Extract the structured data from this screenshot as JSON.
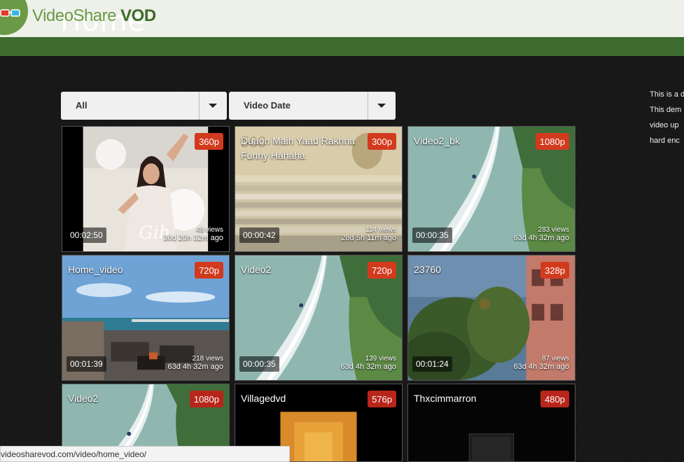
{
  "header": {
    "ghost_title": "Home",
    "logo_part1": "VideoShare",
    "logo_part2": "VOD"
  },
  "filters": {
    "category_selected": "All",
    "sort_selected": "Video Date"
  },
  "videos": [
    {
      "title": "",
      "quality": "360p",
      "duration": "00:02:50",
      "views": "48 views",
      "ago": "30d 20h 32m ago",
      "badge_color": "#d23a1e"
    },
    {
      "title": "Duaon Main Yaad Rakhna Funny Hahaha",
      "quality": "300p",
      "duration": "00:00:42",
      "views": "114 views",
      "ago": "28d 5h 11m ago",
      "badge_color": "#d23a1e"
    },
    {
      "title": "Video2_bk",
      "quality": "1080p",
      "duration": "00:00:35",
      "views": "283 views",
      "ago": "63d 4h 32m ago",
      "badge_color": "#d23a1e"
    },
    {
      "title": "Home_video",
      "quality": "720p",
      "duration": "00:01:39",
      "views": "218 views",
      "ago": "63d 4h 32m ago",
      "badge_color": "#d23a1e"
    },
    {
      "title": "Video2",
      "quality": "720p",
      "duration": "00:00:35",
      "views": "139 views",
      "ago": "63d 4h 32m ago",
      "badge_color": "#d23a1e"
    },
    {
      "title": "23760",
      "quality": "328p",
      "duration": "00:01:24",
      "views": "87 views",
      "ago": "63d 4h 32m ago",
      "badge_color": "#d23a1e"
    },
    {
      "title": "Video2",
      "quality": "1080p",
      "duration": "",
      "views": "",
      "ago": "",
      "badge_color": "#b8261b"
    },
    {
      "title": "Villagedvd",
      "quality": "576p",
      "duration": "",
      "views": "",
      "ago": "",
      "badge_color": "#b8261b"
    },
    {
      "title": "Thxcimmarron",
      "quality": "480p",
      "duration": "",
      "views": "",
      "ago": "",
      "badge_color": "#b8261b"
    }
  ],
  "sidebar": {
    "lines": [
      "This is a d",
      "This dem",
      "video up",
      "hard enc"
    ]
  },
  "status": {
    "url": "videosharevod.com/video/home_video/"
  },
  "colors": {
    "header_bg": "#eef0ea",
    "green_bar": "#3e6b2f",
    "logo_green": "#6a9a45",
    "page_bg": "#161616",
    "badge_red": "#d23a1e"
  }
}
